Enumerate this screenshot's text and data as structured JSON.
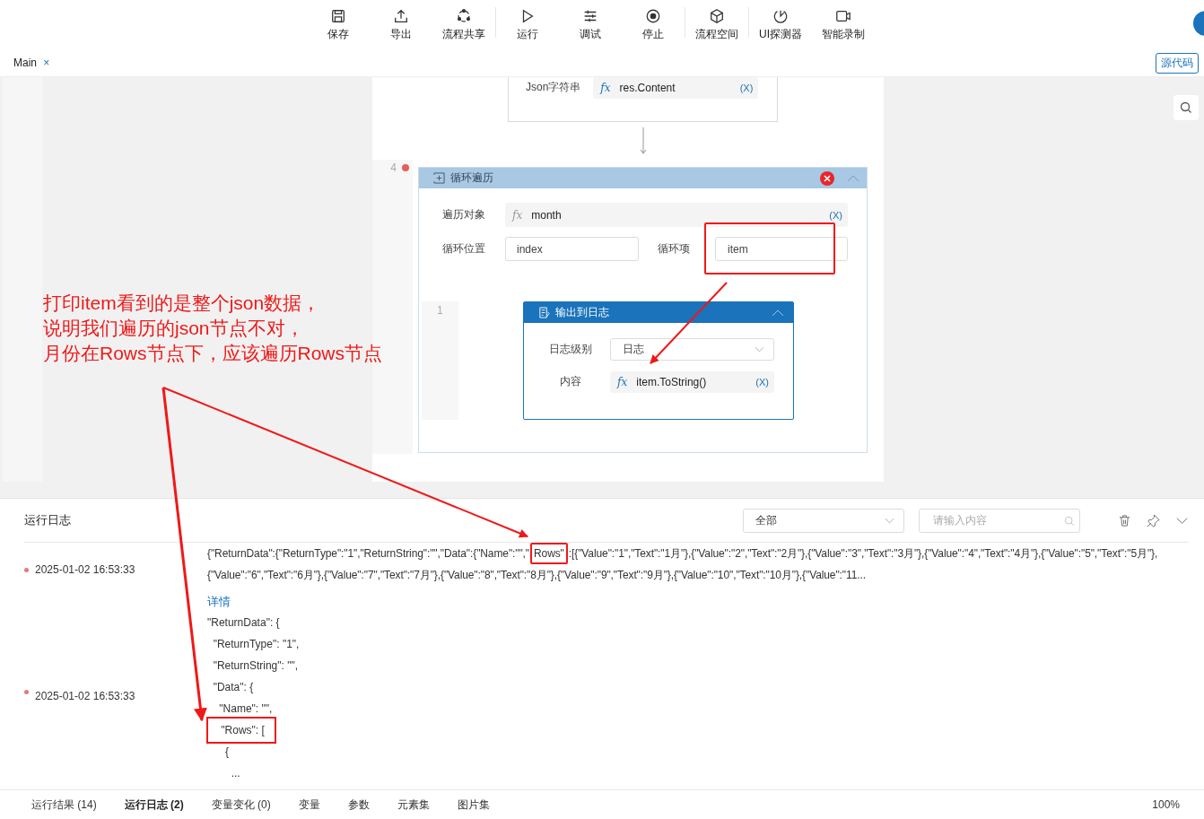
{
  "toolbar": {
    "groups": [
      [
        "保存",
        "导出",
        "流程共享"
      ],
      [
        "运行",
        "调试",
        "停止"
      ],
      [
        "流程空间"
      ],
      [
        "UI探测器",
        "智能录制"
      ]
    ]
  },
  "tabs": [
    {
      "label": "Main",
      "close": "×",
      "selected": true
    }
  ],
  "source_button": "源代码",
  "canvas": {
    "prev_node": {
      "label": "Json字符串",
      "fx": "fx",
      "value": "res.Content",
      "var": "(X)"
    },
    "loop_node": {
      "line": "4",
      "title": "循环遍历",
      "target_label": "遍历对象",
      "target_fx": "fx",
      "target_value": "month",
      "target_var": "(X)",
      "index_label": "循环位置",
      "index_value": "index",
      "item_label": "循环项",
      "item_value": "item",
      "child_line": "1",
      "child": {
        "title": "输出到日志",
        "level_label": "日志级别",
        "level_value": "日志",
        "content_label": "内容",
        "content_fx": "fx",
        "content_value": "item.ToString()",
        "content_var": "(X)"
      }
    }
  },
  "annotation": {
    "lines": [
      "打印item看到的是整个json数据，",
      "说明我们遍历的json节点不对，",
      "月份在Rows节点下，应该遍历Rows节点"
    ]
  },
  "log": {
    "title": "运行日志",
    "filter": "全部",
    "search_placeholder": "请输入内容",
    "entries": [
      {
        "kind": "raw",
        "time": "2025-01-02 16:53:33",
        "lines": [
          [
            {
              "text": "{\"ReturnData\":{\"ReturnType\":\"1\",\"ReturnString\":\"\",\"Data\":{\"Name\":\"\",\"",
              "highlighted": false
            },
            {
              "text": "Rows\"",
              "highlighted": true
            },
            {
              "text": ":[{\"Value\":\"1\",\"Text\":\"1月\"},{\"Value\":\"2\",\"Text\":\"2月\"},{\"Value\":\"3\",\"Text\":\"3月\"},{\"Value\":\"4\",\"Text\":\"4月\"},{\"Value\":\"5\",\"Text\":\"5月\"},",
              "highlighted": false
            }
          ],
          [
            {
              "text": "{\"Value\":\"6\",\"Text\":\"6月\"},{\"Value\":\"7\",\"Text\":\"7月\"},{\"Value\":\"8\",\"Text\":\"8月\"},{\"Value\":\"9\",\"Text\":\"9月\"},{\"Value\":\"10\",\"Text\":\"10月\"},{\"Value\":\"11..."
            }
          ]
        ]
      },
      {
        "kind": "detail",
        "time": "2025-01-02 16:53:33",
        "link": "详情",
        "lines": [
          {
            "text": "\"ReturnData\": {",
            "highlighted": false
          },
          {
            "text": "  \"ReturnType\": \"1\",",
            "highlighted": false
          },
          {
            "text": "  \"ReturnString\": \"\",",
            "highlighted": false
          },
          {
            "text": "  \"Data\": {",
            "highlighted": false
          },
          {
            "text": "    \"Name\": \"\",",
            "highlighted": false
          },
          {
            "text": "    \"Rows\": [",
            "highlighted": true
          },
          {
            "text": "      {",
            "highlighted": false
          },
          {
            "text": "        ...",
            "highlighted": false
          }
        ]
      }
    ]
  },
  "bottom_tabs": [
    {
      "label": "运行结果 (14)",
      "selected": false
    },
    {
      "label": "运行日志 (2)",
      "selected": true
    },
    {
      "label": "变量变化 (0)",
      "selected": false
    },
    {
      "label": "变量",
      "selected": false
    },
    {
      "label": "参数",
      "selected": false
    },
    {
      "label": "元素集",
      "selected": false
    },
    {
      "label": "图片集",
      "selected": false
    }
  ],
  "zoom": "100%"
}
